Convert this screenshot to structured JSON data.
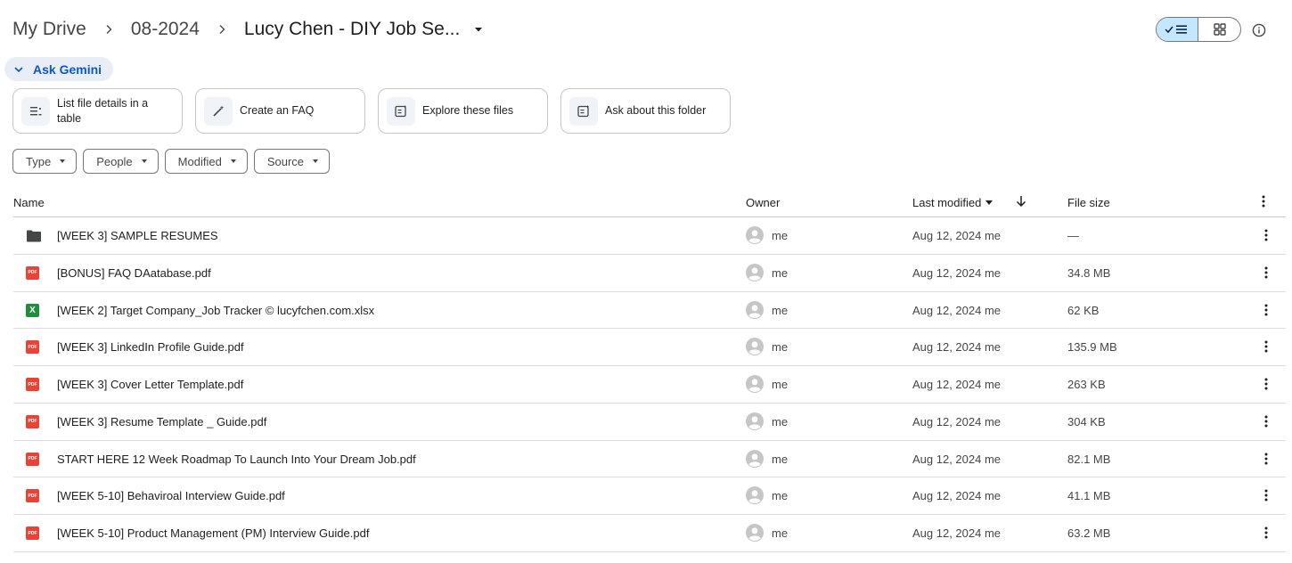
{
  "breadcrumb": {
    "items": [
      "My Drive",
      "08-2024",
      "Lucy Chen - DIY Job Se..."
    ]
  },
  "view": {
    "list_icon": "check-list-icon",
    "grid_icon": "grid-icon",
    "info_icon": "info-icon",
    "active": "list"
  },
  "gemini": {
    "label": "Ask Gemini",
    "suggestions": [
      {
        "label": "List file details in a table",
        "icon": "table-list-icon"
      },
      {
        "label": "Create an FAQ",
        "icon": "magic-wand-icon"
      },
      {
        "label": "Explore these files",
        "icon": "explore-files-icon"
      },
      {
        "label": "Ask about this folder",
        "icon": "folder-question-icon"
      }
    ]
  },
  "filters": [
    "Type",
    "People",
    "Modified",
    "Source"
  ],
  "table": {
    "headers": {
      "name": "Name",
      "owner": "Owner",
      "modified": "Last modified",
      "size": "File size"
    },
    "rows": [
      {
        "type": "folder",
        "name": "[WEEK 3] SAMPLE RESUMES",
        "owner": "me",
        "modified": "Aug 12, 2024 me",
        "size": "—"
      },
      {
        "type": "pdf",
        "name": "[BONUS] FAQ DAatabase.pdf",
        "owner": "me",
        "modified": "Aug 12, 2024 me",
        "size": "34.8 MB"
      },
      {
        "type": "xlsx",
        "name": "[WEEK 2] Target Company_Job Tracker © lucyfchen.com.xlsx",
        "owner": "me",
        "modified": "Aug 12, 2024 me",
        "size": "62 KB"
      },
      {
        "type": "pdf",
        "name": "[WEEK 3] LinkedIn Profile Guide.pdf",
        "owner": "me",
        "modified": "Aug 12, 2024 me",
        "size": "135.9 MB"
      },
      {
        "type": "pdf",
        "name": "[WEEK 3] Cover Letter Template.pdf",
        "owner": "me",
        "modified": "Aug 12, 2024 me",
        "size": "263 KB"
      },
      {
        "type": "pdf",
        "name": "[WEEK 3] Resume Template _ Guide.pdf",
        "owner": "me",
        "modified": "Aug 12, 2024 me",
        "size": "304 KB"
      },
      {
        "type": "pdf",
        "name": "START HERE 12 Week Roadmap To Launch Into Your Dream Job.pdf",
        "owner": "me",
        "modified": "Aug 12, 2024 me",
        "size": "82.1 MB"
      },
      {
        "type": "pdf",
        "name": "[WEEK 5-10] Behaviroal Interview Guide.pdf",
        "owner": "me",
        "modified": "Aug 12, 2024 me",
        "size": "41.1 MB"
      },
      {
        "type": "pdf",
        "name": "[WEEK 5-10] Product Management (PM) Interview Guide.pdf",
        "owner": "me",
        "modified": "Aug 12, 2024 me",
        "size": "63.2 MB"
      }
    ]
  },
  "colors": {
    "accent": "#0b57d0",
    "active_view": "#c2e7ff",
    "pdf": "#ea4335",
    "xlsx": "#1e8e3e"
  }
}
